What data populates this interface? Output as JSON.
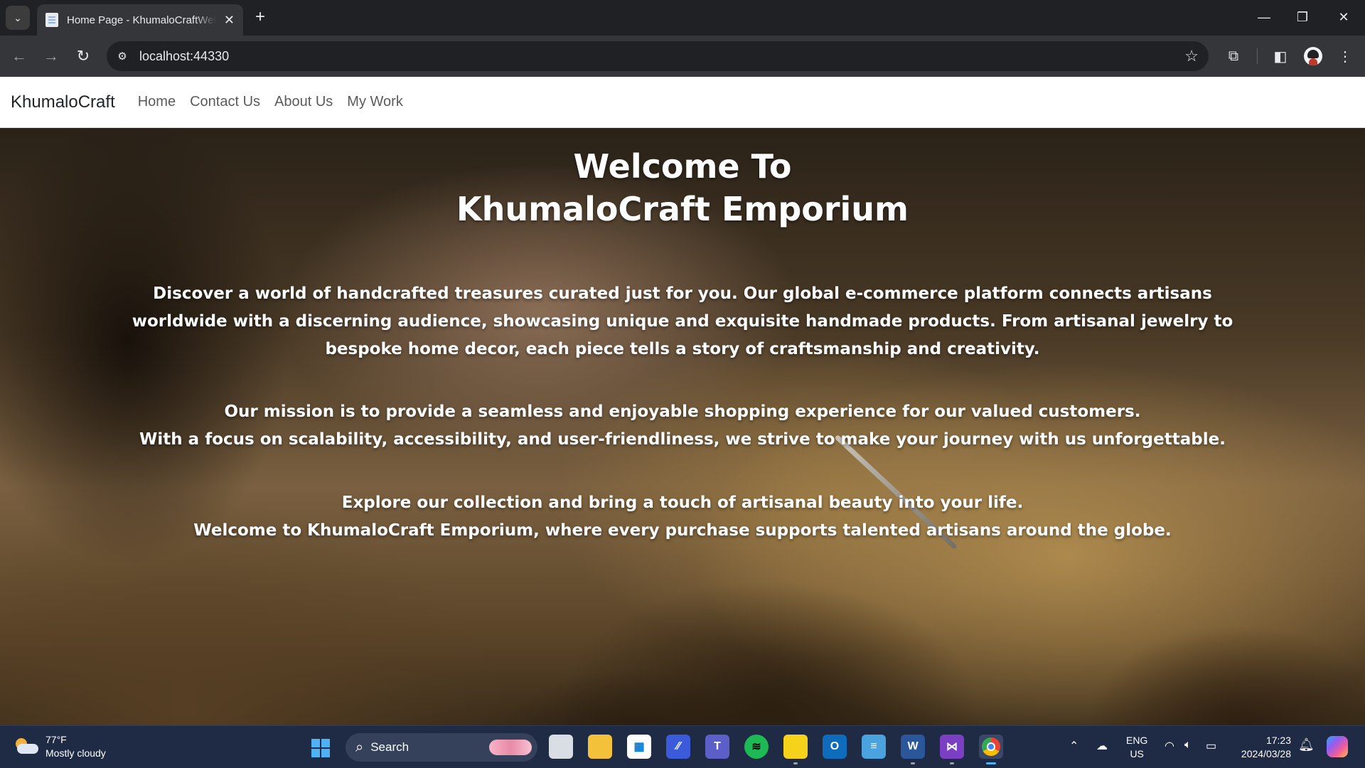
{
  "browser": {
    "tab_title": "Home Page - KhumaloCraftWeb",
    "url": "localhost:44330",
    "icons": [
      "tab-search-icon",
      "tab-favicon-icon",
      "tab-close-icon",
      "new-tab-icon",
      "minimize-icon",
      "restore-icon",
      "close-window-icon",
      "back-icon",
      "forward-icon",
      "reload-icon",
      "site-info-icon",
      "bookmark-star-icon",
      "extensions-icon",
      "side-panel-icon",
      "profile-avatar",
      "menu-icon"
    ]
  },
  "navbar": {
    "brand": "KhumaloCraft",
    "links": [
      "Home",
      "Contact Us",
      "About Us",
      "My Work"
    ]
  },
  "hero": {
    "title_line1": "Welcome To",
    "title_line2": "KhumaloCraft Emporium",
    "paragraph1": "Discover a world of handcrafted treasures curated just for you. Our global e-commerce platform connects artisans worldwide with a discerning audience, showcasing unique and exquisite handmade products. From artisanal jewelry to bespoke home decor, each piece tells a story of craftsmanship and creativity.",
    "paragraph2_line1": "Our mission is to provide a seamless and enjoyable shopping experience for our valued customers.",
    "paragraph2_line2": "With a focus on scalability, accessibility, and user-friendliness, we strive to make your journey with us unforgettable.",
    "paragraph3_line1": "Explore our collection and bring a touch of artisanal beauty into your life.",
    "paragraph3_line2": "Welcome to KhumaloCraft Emporium, where every purchase supports talented artisans around the globe."
  },
  "taskbar": {
    "weather_temp": "77°F",
    "weather_desc": "Mostly cloudy",
    "search_label": "Search",
    "lang_line1": "ENG",
    "lang_line2": "US",
    "time": "17:23",
    "date": "2024/03/28",
    "apps": [
      "task-view",
      "file-explorer",
      "microsoft-store",
      "visual-studio-code-alt",
      "teams",
      "spotify",
      "sticky-notes",
      "outlook-new",
      "notepad",
      "word",
      "visual-studio",
      "chrome"
    ]
  }
}
